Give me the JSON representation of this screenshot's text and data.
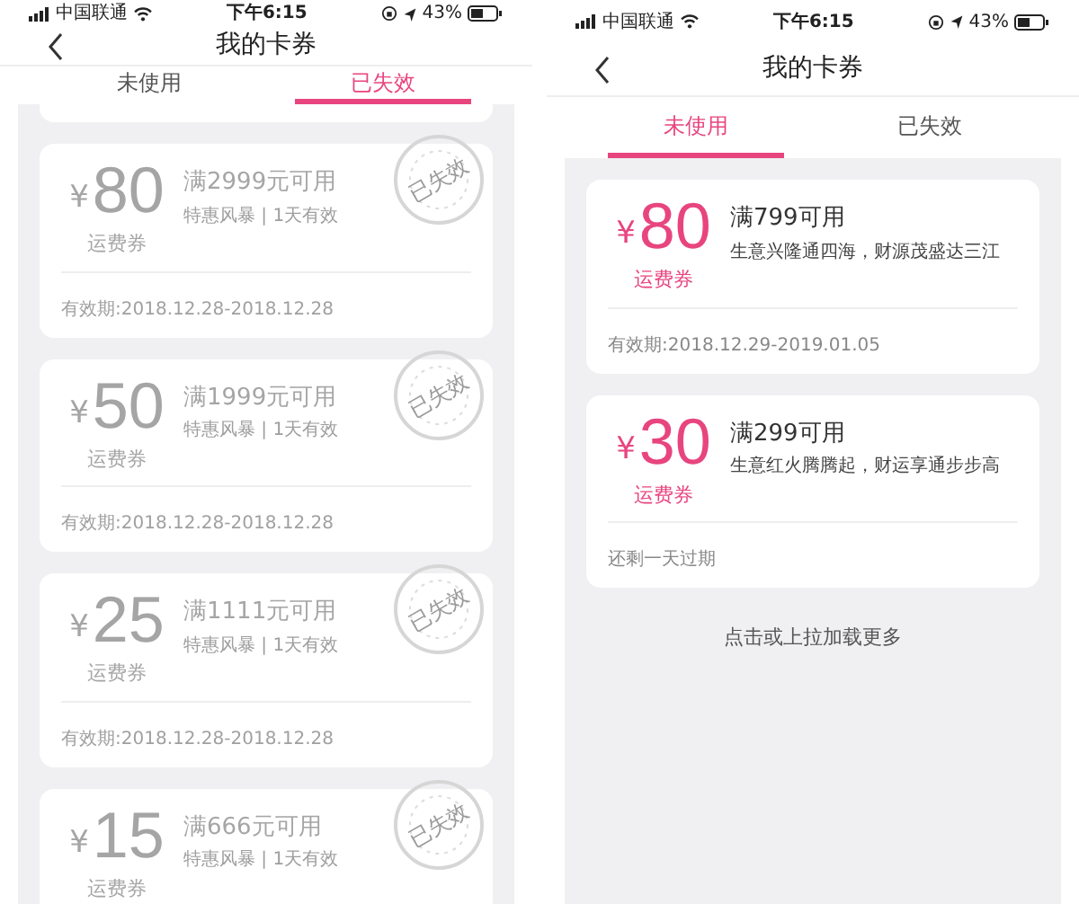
{
  "phones": [
    {
      "status_bar": {
        "carrier": "中国联通",
        "time": "下午6:15",
        "battery": "43%"
      },
      "title": "我的卡券",
      "tabs": [
        {
          "label": "未使用",
          "selected": false
        },
        {
          "label": "已失效",
          "selected": true
        }
      ],
      "partial_card_above": true,
      "coupons": [
        {
          "currency": "¥",
          "amount": "80",
          "label": "运费券",
          "condition": "满2999元可用",
          "desc": "特惠风暴 | 1天有效",
          "validity": "有效期:2018.12.28-2018.12.28",
          "expired": true,
          "stamp": "已失效"
        },
        {
          "currency": "¥",
          "amount": "50",
          "label": "运费券",
          "condition": "满1999元可用",
          "desc": "特惠风暴 | 1天有效",
          "validity": "有效期:2018.12.28-2018.12.28",
          "expired": true,
          "stamp": "已失效"
        },
        {
          "currency": "¥",
          "amount": "25",
          "label": "运费券",
          "condition": "满1111元可用",
          "desc": "特惠风暴 | 1天有效",
          "validity": "有效期:2018.12.28-2018.12.28",
          "expired": true,
          "stamp": "已失效"
        },
        {
          "currency": "¥",
          "amount": "15",
          "label": "运费券",
          "condition": "满666元可用",
          "desc": "特惠风暴 | 1天有效",
          "expired": true,
          "stamp": "已失效"
        }
      ]
    },
    {
      "status_bar": {
        "carrier": "中国联通",
        "time": "下午6:15",
        "battery": "43%"
      },
      "title": "我的卡券",
      "tabs": [
        {
          "label": "未使用",
          "selected": true
        },
        {
          "label": "已失效",
          "selected": false
        }
      ],
      "coupons": [
        {
          "currency": "¥",
          "amount": "80",
          "label": "运费券",
          "condition": "满799可用",
          "desc": "生意兴隆通四海，财源茂盛达三江",
          "validity": "有效期:2018.12.29-2019.01.05",
          "expired": false
        },
        {
          "currency": "¥",
          "amount": "30",
          "label": "运费券",
          "condition": "满299可用",
          "desc": "生意红火腾腾起，财运享通步步高",
          "validity": "还剩一天过期",
          "expired": false
        }
      ],
      "footer": "点击或上拉加载更多"
    }
  ]
}
